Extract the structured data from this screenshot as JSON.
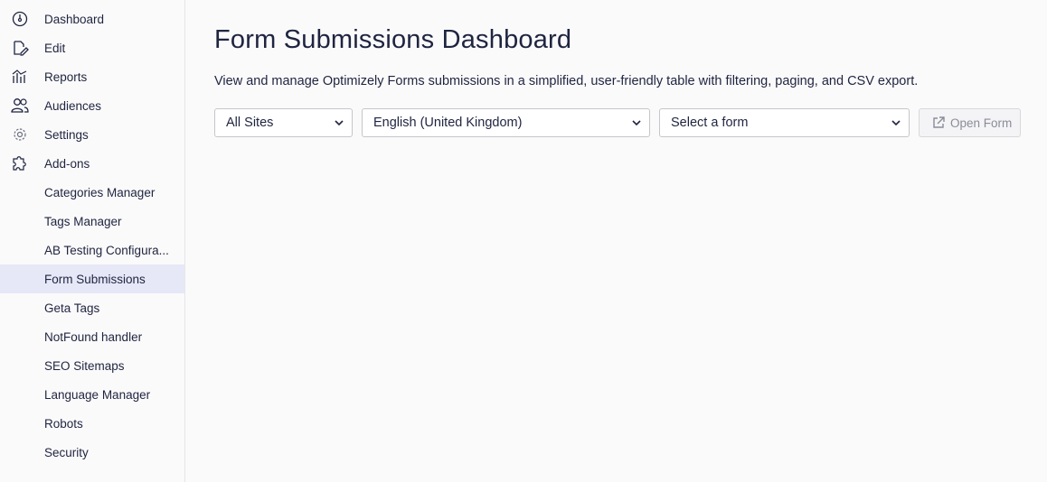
{
  "sidebar": {
    "items": [
      {
        "label": "Dashboard",
        "icon": "dashboard-icon"
      },
      {
        "label": "Edit",
        "icon": "edit-icon"
      },
      {
        "label": "Reports",
        "icon": "reports-icon"
      },
      {
        "label": "Audiences",
        "icon": "audiences-icon"
      },
      {
        "label": "Settings",
        "icon": "gear-icon"
      },
      {
        "label": "Add-ons",
        "icon": "puzzle-icon"
      }
    ],
    "addons": [
      "Categories Manager",
      "Tags Manager",
      "AB Testing Configura...",
      "Form Submissions",
      "Geta Tags",
      "NotFound handler",
      "SEO Sitemaps",
      "Language Manager",
      "Robots",
      "Security"
    ],
    "active_addon": "Form Submissions"
  },
  "main": {
    "title": "Form Submissions Dashboard",
    "description": "View and manage Optimizely Forms submissions in a simplified, user-friendly table with filtering, paging, and CSV export.",
    "site_select": "All Sites",
    "language_select": "English (United Kingdom)",
    "form_select": "Select a form",
    "open_form_label": "Open Form"
  },
  "colors": {
    "active_bg": "#e6e8f7",
    "text": "#1f2440",
    "disabled_text": "#8a8c98"
  }
}
